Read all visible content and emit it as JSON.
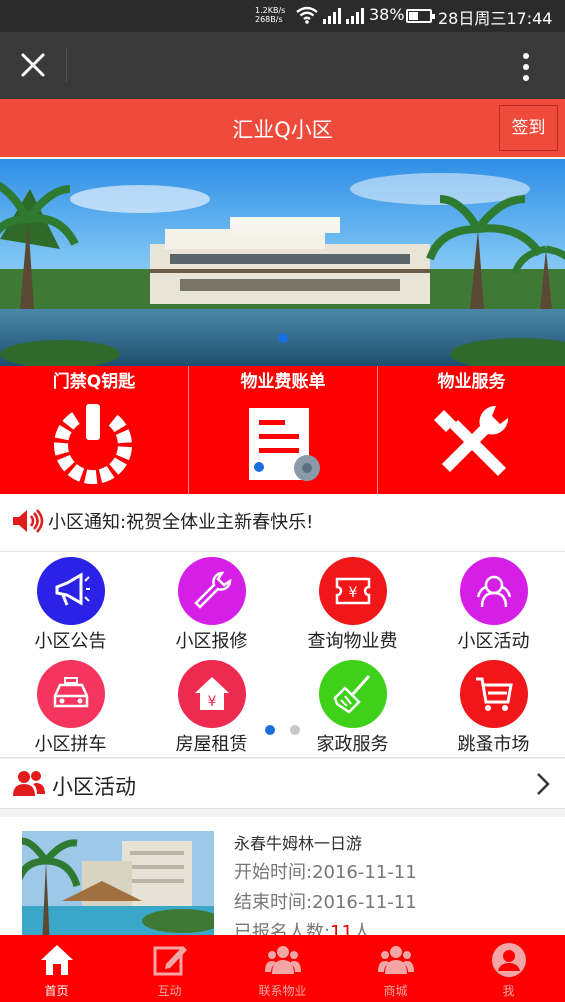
{
  "status_bar": {
    "net_up": "1.2KB/s",
    "net_down": "268B/s",
    "battery": "38%",
    "clock": "28日周三17:44"
  },
  "browser": {
    "close_icon": "close-icon",
    "more_icon": "more-vertical-icon"
  },
  "header": {
    "title": "汇业Q小区",
    "signin": "签到",
    "color": "#ef4b3c"
  },
  "banner": {
    "image": "villa-by-lake",
    "indicator": "carousel-dot"
  },
  "tiles": [
    {
      "label": "门禁Q钥匙",
      "icon": "power-icon"
    },
    {
      "label": "物业费账单",
      "icon": "bill-document-icon"
    },
    {
      "label": "物业服务",
      "icon": "tools-icon"
    }
  ],
  "notice": {
    "label": "小区通知:",
    "text": "祝贺全体业主新春快乐!",
    "icon": "speaker-icon"
  },
  "services": [
    {
      "label": "小区公告",
      "color": "#2a22e6",
      "icon": "megaphone-icon"
    },
    {
      "label": "小区报修",
      "color": "#d51fe6",
      "icon": "wrench-icon"
    },
    {
      "label": "查询物业费",
      "color": "#f0161a",
      "icon": "ticket-yen-icon"
    },
    {
      "label": "小区活动",
      "color": "#d51fe6",
      "icon": "activity-people-icon"
    },
    {
      "label": "小区拼车",
      "color": "#f5355e",
      "icon": "taxi-icon"
    },
    {
      "label": "房屋租赁",
      "color": "#ee2a50",
      "icon": "house-yen-icon"
    },
    {
      "label": "家政服务",
      "color": "#3fd11a",
      "icon": "broom-icon"
    },
    {
      "label": "跳蚤市场",
      "color": "#f0161a",
      "icon": "cart-icon"
    }
  ],
  "activities": {
    "heading": "小区活动",
    "items": [
      {
        "name": "永春牛姆林一日游",
        "start": "开始时间:2016-11-11",
        "end": "结束时间:2016-11-11",
        "count_prefix": "已报名人数:",
        "count": "11",
        "count_suffix": "人"
      }
    ]
  },
  "nav": [
    {
      "label": "首页",
      "icon": "home-icon",
      "active": true
    },
    {
      "label": "互动",
      "icon": "edit-icon",
      "active": false
    },
    {
      "label": "联系物业",
      "icon": "group-icon",
      "active": false
    },
    {
      "label": "商城",
      "icon": "group-icon",
      "active": false
    },
    {
      "label": "我",
      "icon": "user-icon",
      "active": false
    }
  ]
}
